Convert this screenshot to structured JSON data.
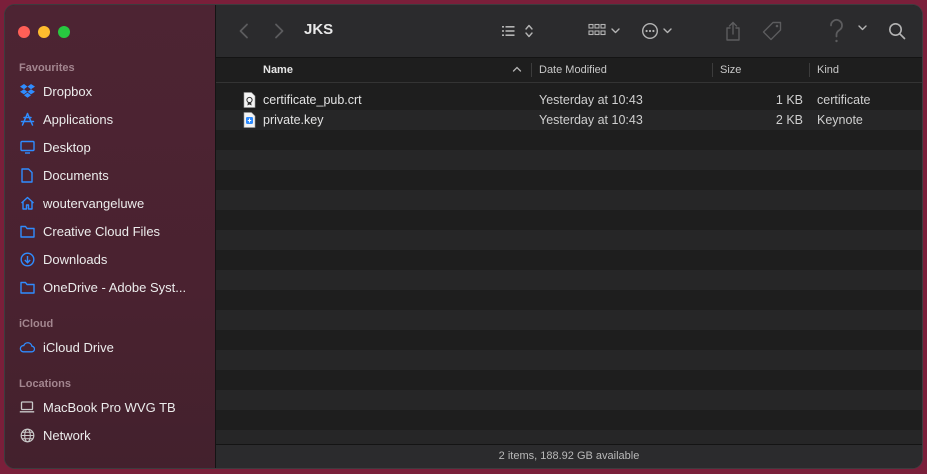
{
  "window": {
    "title": "JKS"
  },
  "sidebar": {
    "sections": [
      {
        "label": "Favourites"
      },
      {
        "label": "iCloud"
      },
      {
        "label": "Locations"
      }
    ],
    "favourites": [
      {
        "label": "Dropbox",
        "icon": "dropbox-icon"
      },
      {
        "label": "Applications",
        "icon": "applications-icon"
      },
      {
        "label": "Desktop",
        "icon": "desktop-icon"
      },
      {
        "label": "Documents",
        "icon": "document-icon"
      },
      {
        "label": "woutervangeluwe",
        "icon": "home-icon"
      },
      {
        "label": "Creative Cloud Files",
        "icon": "folder-icon"
      },
      {
        "label": "Downloads",
        "icon": "downloads-icon"
      },
      {
        "label": "OneDrive - Adobe Syst...",
        "icon": "folder-icon"
      }
    ],
    "icloud": [
      {
        "label": "iCloud Drive",
        "icon": "cloud-icon"
      }
    ],
    "locations": [
      {
        "label": "MacBook Pro WVG TB",
        "icon": "laptop-icon"
      },
      {
        "label": "Network",
        "icon": "globe-icon"
      }
    ]
  },
  "columns": {
    "name": "Name",
    "date": "Date Modified",
    "size": "Size",
    "kind": "Kind"
  },
  "files": [
    {
      "name": "certificate_pub.crt",
      "date": "Yesterday at 10:43",
      "size": "1 KB",
      "kind": "certificate",
      "icon": "certificate-file-icon"
    },
    {
      "name": "private.key",
      "date": "Yesterday at 10:43",
      "size": "2 KB",
      "kind": "Keynote",
      "icon": "key-file-icon"
    }
  ],
  "status": {
    "text": "2 items, 188.92 GB available"
  },
  "colors": {
    "accent": "#2f8cff",
    "sidebar_bg": "#4a2230",
    "content_bg": "#1e1e1e",
    "alt_row": "#262627"
  }
}
